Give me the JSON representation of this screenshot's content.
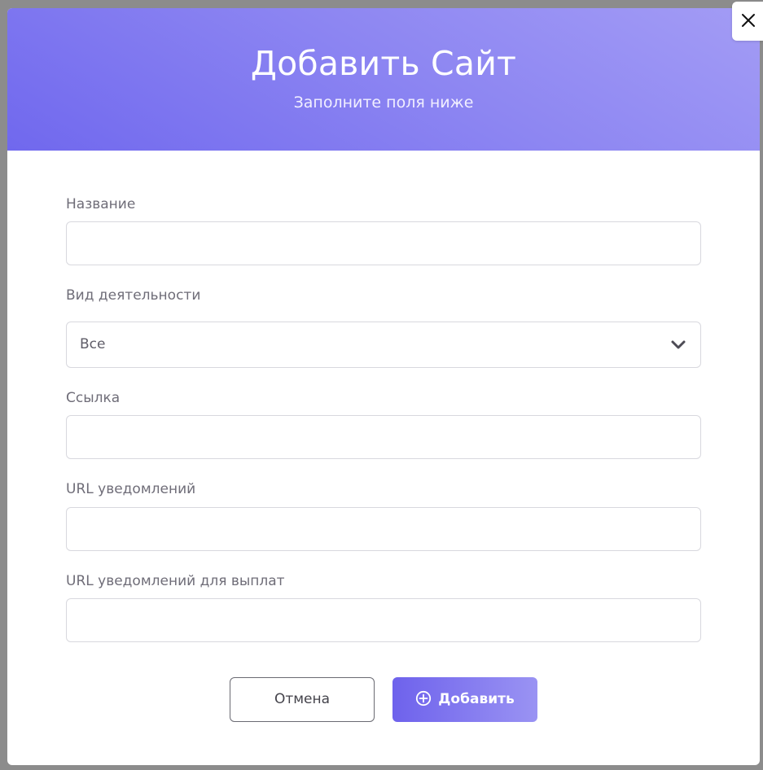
{
  "modal": {
    "title": "Добавить Сайт",
    "subtitle": "Заполните поля ниже"
  },
  "form": {
    "name": {
      "label": "Название",
      "value": ""
    },
    "activity": {
      "label": "Вид деятельности",
      "selected": "Все"
    },
    "link": {
      "label": "Ссылка",
      "value": ""
    },
    "notify_url": {
      "label": "URL уведомлений",
      "value": ""
    },
    "payout_notify_url": {
      "label": "URL уведомлений для выплат",
      "value": ""
    }
  },
  "actions": {
    "cancel_label": "Отмена",
    "add_label": "Добавить"
  },
  "icons": {
    "close": "close-icon",
    "chevron": "chevron-down-icon",
    "add": "plus-circle-icon"
  },
  "colors": {
    "accent": "#7068ee",
    "accent_light": "#a39cf5"
  }
}
